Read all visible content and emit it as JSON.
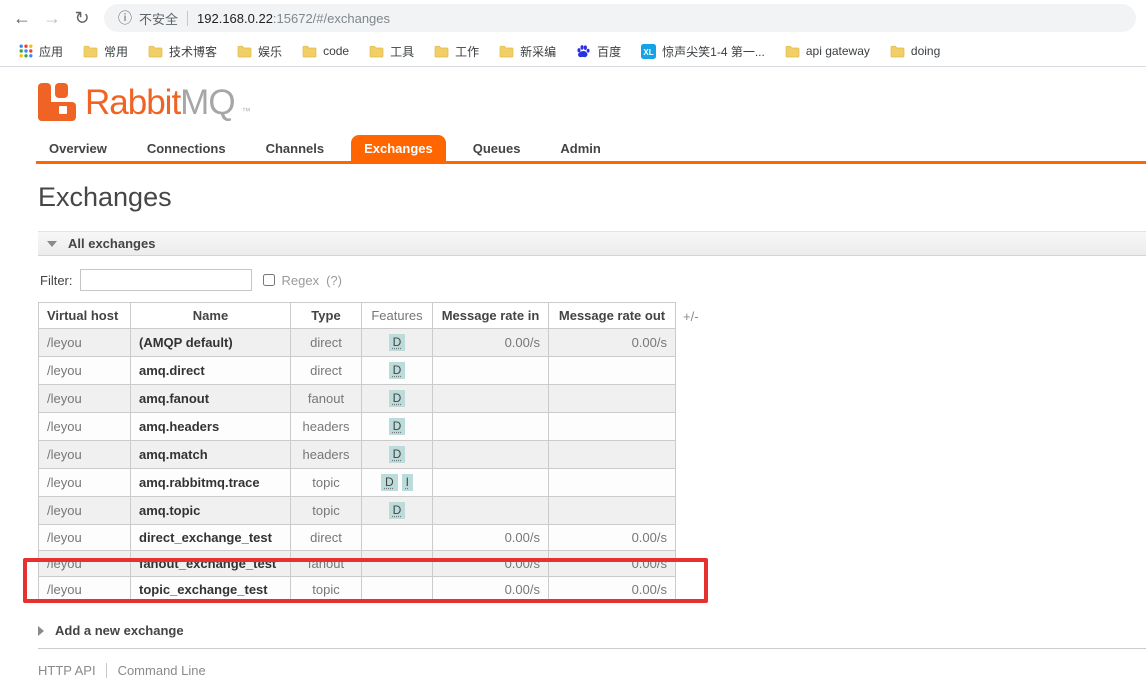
{
  "browser": {
    "back_icon": "←",
    "forward_icon": "→",
    "refresh_icon": "↻",
    "info_icon": "ⓘ",
    "security_label": "不安全",
    "url_host": "192.168.0.22",
    "url_rest": ":15672/#/exchanges",
    "bookmarks": [
      {
        "label": "应用",
        "icon": "apps-grid-icon"
      },
      {
        "label": "常用",
        "icon": "folder-icon"
      },
      {
        "label": "技术博客",
        "icon": "folder-icon"
      },
      {
        "label": "娱乐",
        "icon": "folder-icon"
      },
      {
        "label": "code",
        "icon": "folder-icon"
      },
      {
        "label": "工具",
        "icon": "folder-icon"
      },
      {
        "label": "工作",
        "icon": "folder-icon"
      },
      {
        "label": "新采编",
        "icon": "folder-icon"
      },
      {
        "label": "百度",
        "icon": "baidu-icon"
      },
      {
        "label": "惊声尖笑1-4 第一...",
        "icon": "xunlei-icon"
      },
      {
        "label": "api gateway",
        "icon": "folder-icon"
      },
      {
        "label": "doing",
        "icon": "folder-icon"
      }
    ]
  },
  "logo": {
    "rabbit": "Rabbit",
    "mq": "MQ",
    "tm": "™"
  },
  "tabs": [
    {
      "label": "Overview",
      "active": false
    },
    {
      "label": "Connections",
      "active": false
    },
    {
      "label": "Channels",
      "active": false
    },
    {
      "label": "Exchanges",
      "active": true
    },
    {
      "label": "Queues",
      "active": false
    },
    {
      "label": "Admin",
      "active": false
    }
  ],
  "page": {
    "title": "Exchanges",
    "all_exchanges_section": "All exchanges",
    "filter_label": "Filter:",
    "filter_value": "",
    "regex_label": "Regex",
    "regex_help": "(?)",
    "add_exchange_section": "Add a new exchange"
  },
  "table": {
    "columns": [
      "Virtual host",
      "Name",
      "Type",
      "Features",
      "Message rate in",
      "Message rate out"
    ],
    "column_toggle": "+/-",
    "rows": [
      {
        "vhost": "/leyou",
        "name": "(AMQP default)",
        "type": "direct",
        "features": [
          "D"
        ],
        "rate_in": "0.00/s",
        "rate_out": "0.00/s",
        "highlighted": false
      },
      {
        "vhost": "/leyou",
        "name": "amq.direct",
        "type": "direct",
        "features": [
          "D"
        ],
        "rate_in": "",
        "rate_out": "",
        "highlighted": false
      },
      {
        "vhost": "/leyou",
        "name": "amq.fanout",
        "type": "fanout",
        "features": [
          "D"
        ],
        "rate_in": "",
        "rate_out": "",
        "highlighted": false
      },
      {
        "vhost": "/leyou",
        "name": "amq.headers",
        "type": "headers",
        "features": [
          "D"
        ],
        "rate_in": "",
        "rate_out": "",
        "highlighted": false
      },
      {
        "vhost": "/leyou",
        "name": "amq.match",
        "type": "headers",
        "features": [
          "D"
        ],
        "rate_in": "",
        "rate_out": "",
        "highlighted": false
      },
      {
        "vhost": "/leyou",
        "name": "amq.rabbitmq.trace",
        "type": "topic",
        "features": [
          "D",
          "I"
        ],
        "rate_in": "",
        "rate_out": "",
        "highlighted": false
      },
      {
        "vhost": "/leyou",
        "name": "amq.topic",
        "type": "topic",
        "features": [
          "D"
        ],
        "rate_in": "",
        "rate_out": "",
        "highlighted": false
      },
      {
        "vhost": "/leyou",
        "name": "direct_exchange_test",
        "type": "direct",
        "features": [],
        "rate_in": "0.00/s",
        "rate_out": "0.00/s",
        "highlighted": false
      },
      {
        "vhost": "/leyou",
        "name": "fanout_exchange_test",
        "type": "fanout",
        "features": [],
        "rate_in": "0.00/s",
        "rate_out": "0.00/s",
        "highlighted": false
      },
      {
        "vhost": "/leyou",
        "name": "topic_exchange_test",
        "type": "topic",
        "features": [],
        "rate_in": "0.00/s",
        "rate_out": "0.00/s",
        "highlighted": true
      }
    ]
  },
  "footer": {
    "http_api": "HTTP API",
    "command_line": "Command Line"
  },
  "colors": {
    "accent_orange": "#ff6600",
    "logo_orange": "#ef6425",
    "feature_badge_bg": "#bcdcdc",
    "highlight_red": "#e5322e"
  }
}
